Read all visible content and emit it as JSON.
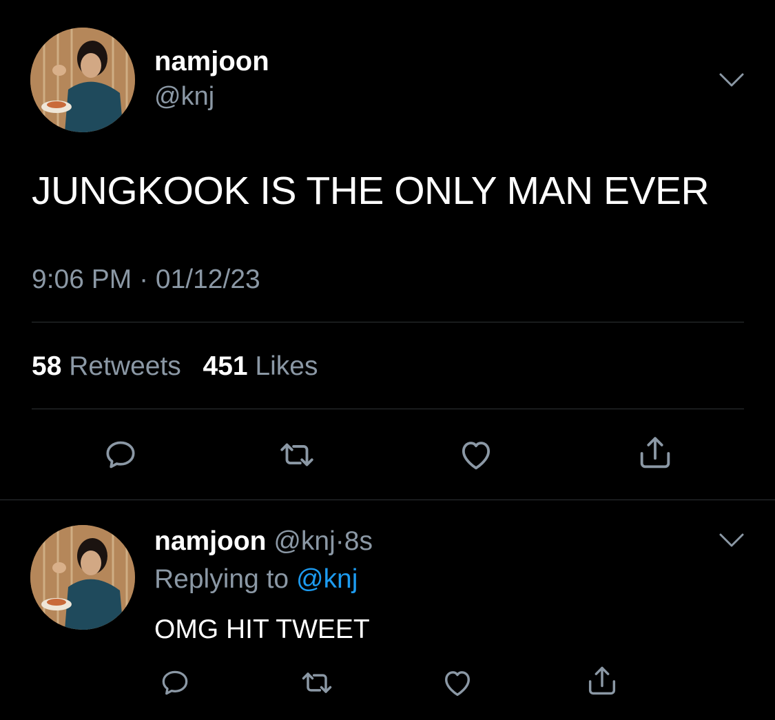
{
  "colors": {
    "background": "#000000",
    "text": "#ffffff",
    "muted": "#8b98a5",
    "link": "#1d9bf0",
    "divider": "#2f3336"
  },
  "main_tweet": {
    "display_name": "namjoon",
    "handle": "@knj",
    "avatar_icon": "profile-photo",
    "menu_icon": "chevron-down-icon",
    "text": "JUNGKOOK IS THE ONLY MAN EVER",
    "timestamp": "9:06 PM · 01/12/23",
    "stats": {
      "retweets_count": "58",
      "retweets_label": "Retweets",
      "likes_count": "451",
      "likes_label": "Likes"
    },
    "actions": [
      "reply-icon",
      "retweet-icon",
      "like-icon",
      "share-icon"
    ]
  },
  "reply_tweet": {
    "display_name": "namjoon",
    "handle": "@knj",
    "separator": "·",
    "age": "8s",
    "replying_label": "Replying to",
    "replying_handle": "@knj",
    "text": "OMG HIT TWEET",
    "actions": [
      "reply-icon",
      "retweet-icon",
      "like-icon",
      "share-icon"
    ]
  }
}
